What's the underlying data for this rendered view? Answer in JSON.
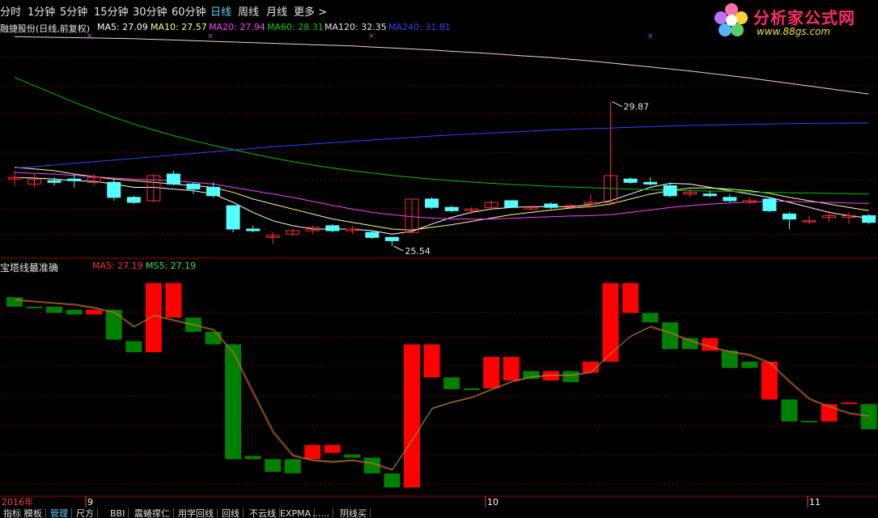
{
  "tabs": [
    {
      "label": "分时",
      "active": false
    },
    {
      "label": "1分钟",
      "active": false
    },
    {
      "label": "5分钟",
      "active": false
    },
    {
      "label": "15分钟",
      "active": false
    },
    {
      "label": "30分钟",
      "active": false
    },
    {
      "label": "60分钟",
      "active": false
    },
    {
      "label": "日线",
      "active": true
    },
    {
      "label": "周线",
      "active": false
    },
    {
      "label": "月线",
      "active": false
    },
    {
      "label": "更多 >",
      "active": false
    }
  ],
  "logo": {
    "text": "分析家公式网",
    "url": "www.88gs.com"
  },
  "main_legend": {
    "stock": "融捷股份(日线,前复权)",
    "ma5": "MA5: 27.09",
    "ma10": "MA10: 27.57",
    "ma20": "MA20: 27.94",
    "ma60": "MA60: 28.31",
    "ma120": "MA120: 32.35",
    "ma240": "MA240: 31.81"
  },
  "sub_legend": {
    "title": "宝塔线最准确",
    "ma5": "MA5: 27.19",
    "ms5": "MS5: 27.19"
  },
  "annotations": {
    "high": "29.87",
    "low": "25.54"
  },
  "x_axis": {
    "year": "2016年",
    "months": [
      "9",
      "10",
      "11"
    ]
  },
  "bottom_tabs": [
    "指标",
    "模板",
    "管理",
    "尺方",
    "BBI",
    "震蜷撑仁",
    "用学回线",
    "回线",
    "不云线",
    "EXPMA",
    "......",
    "阴线买"
  ],
  "colors": {
    "up": "#ff3030",
    "down": "#54ffff",
    "tower_up": "#ff0000",
    "tower_down": "#008000",
    "ma5": "#ffffff",
    "ma10": "#ffff80",
    "ma20": "#ff40ff",
    "ma60": "#00c000",
    "ma120": "#ffff80",
    "ma240": "#3040ff",
    "grid": "#7a0000"
  },
  "chart_data": [
    {
      "type": "candlestick",
      "title": "融捷股份(日线,前复权)",
      "candles": [
        {
          "o": 27.6,
          "h": 27.8,
          "l": 27.35,
          "c": 27.55,
          "dir": "up"
        },
        {
          "o": 27.55,
          "h": 27.7,
          "l": 27.3,
          "c": 27.4,
          "dir": "up"
        },
        {
          "o": 27.5,
          "h": 27.6,
          "l": 27.35,
          "c": 27.45,
          "dir": "down"
        },
        {
          "o": 27.55,
          "h": 27.7,
          "l": 27.3,
          "c": 27.5,
          "dir": "down"
        },
        {
          "o": 27.6,
          "h": 27.7,
          "l": 27.35,
          "c": 27.45,
          "dir": "up"
        },
        {
          "o": 27.45,
          "h": 27.55,
          "l": 26.9,
          "c": 27.0,
          "dir": "down"
        },
        {
          "o": 27.0,
          "h": 27.05,
          "l": 26.8,
          "c": 26.85,
          "dir": "down"
        },
        {
          "o": 26.9,
          "h": 27.7,
          "l": 26.85,
          "c": 27.65,
          "dir": "up"
        },
        {
          "o": 27.7,
          "h": 27.8,
          "l": 27.35,
          "c": 27.4,
          "dir": "down"
        },
        {
          "o": 27.4,
          "h": 27.45,
          "l": 27.1,
          "c": 27.25,
          "dir": "down"
        },
        {
          "o": 27.3,
          "h": 27.45,
          "l": 27.0,
          "c": 27.05,
          "dir": "down"
        },
        {
          "o": 26.75,
          "h": 26.75,
          "l": 25.95,
          "c": 26.05,
          "dir": "down"
        },
        {
          "o": 26.05,
          "h": 26.15,
          "l": 25.95,
          "c": 26.0,
          "dir": "down"
        },
        {
          "o": 25.8,
          "h": 25.95,
          "l": 25.6,
          "c": 25.85,
          "dir": "up"
        },
        {
          "o": 25.9,
          "h": 26.05,
          "l": 25.85,
          "c": 26.0,
          "dir": "up"
        },
        {
          "o": 26.0,
          "h": 26.15,
          "l": 25.9,
          "c": 26.1,
          "dir": "up"
        },
        {
          "o": 26.15,
          "h": 26.2,
          "l": 25.95,
          "c": 26.0,
          "dir": "down"
        },
        {
          "o": 26.05,
          "h": 26.15,
          "l": 25.9,
          "c": 26.0,
          "dir": "up"
        },
        {
          "o": 25.95,
          "h": 26.0,
          "l": 25.75,
          "c": 25.8,
          "dir": "down"
        },
        {
          "o": 25.8,
          "h": 25.8,
          "l": 25.54,
          "c": 25.7,
          "dir": "down"
        },
        {
          "o": 25.95,
          "h": 26.95,
          "l": 25.9,
          "c": 26.95,
          "dir": "up"
        },
        {
          "o": 26.95,
          "h": 27.0,
          "l": 26.65,
          "c": 26.7,
          "dir": "down"
        },
        {
          "o": 26.7,
          "h": 26.75,
          "l": 26.55,
          "c": 26.6,
          "dir": "down"
        },
        {
          "o": 26.6,
          "h": 26.7,
          "l": 26.5,
          "c": 26.65,
          "dir": "up"
        },
        {
          "o": 26.7,
          "h": 26.9,
          "l": 26.6,
          "c": 26.85,
          "dir": "up"
        },
        {
          "o": 26.9,
          "h": 26.9,
          "l": 26.7,
          "c": 26.7,
          "dir": "down"
        },
        {
          "o": 26.65,
          "h": 26.75,
          "l": 26.6,
          "c": 26.7,
          "dir": "up"
        },
        {
          "o": 26.8,
          "h": 26.85,
          "l": 26.65,
          "c": 26.7,
          "dir": "down"
        },
        {
          "o": 26.75,
          "h": 26.8,
          "l": 26.65,
          "c": 26.7,
          "dir": "up"
        },
        {
          "o": 26.8,
          "h": 27.1,
          "l": 26.7,
          "c": 26.85,
          "dir": "up"
        },
        {
          "o": 26.85,
          "h": 29.87,
          "l": 26.8,
          "c": 27.65,
          "dir": "up"
        },
        {
          "o": 27.55,
          "h": 27.6,
          "l": 27.4,
          "c": 27.45,
          "dir": "down"
        },
        {
          "o": 27.45,
          "h": 27.6,
          "l": 27.35,
          "c": 27.4,
          "dir": "down"
        },
        {
          "o": 27.35,
          "h": 27.45,
          "l": 27.0,
          "c": 27.05,
          "dir": "down"
        },
        {
          "o": 27.1,
          "h": 27.25,
          "l": 27.0,
          "c": 27.15,
          "dir": "up"
        },
        {
          "o": 27.1,
          "h": 27.2,
          "l": 27.0,
          "c": 27.05,
          "dir": "down"
        },
        {
          "o": 27.0,
          "h": 27.1,
          "l": 26.85,
          "c": 26.9,
          "dir": "down"
        },
        {
          "o": 26.85,
          "h": 27.0,
          "l": 26.8,
          "c": 26.9,
          "dir": "up"
        },
        {
          "o": 26.95,
          "h": 27.0,
          "l": 26.55,
          "c": 26.6,
          "dir": "down"
        },
        {
          "o": 26.5,
          "h": 26.55,
          "l": 26.05,
          "c": 26.35,
          "dir": "down"
        },
        {
          "o": 26.3,
          "h": 26.45,
          "l": 26.2,
          "c": 26.3,
          "dir": "up"
        },
        {
          "o": 26.4,
          "h": 26.6,
          "l": 26.25,
          "c": 26.45,
          "dir": "up"
        },
        {
          "o": 26.45,
          "h": 26.55,
          "l": 26.2,
          "c": 26.4,
          "dir": "up"
        },
        {
          "o": 26.45,
          "h": 26.5,
          "l": 26.2,
          "c": 26.25,
          "dir": "down"
        }
      ],
      "ma": {
        "ma5": [
          27.6,
          27.58,
          27.55,
          27.5,
          27.48,
          27.4,
          27.3,
          27.3,
          27.25,
          27.2,
          27.1,
          26.85,
          26.55,
          26.3,
          26.15,
          26.05,
          26.05,
          26.05,
          26.0,
          25.9,
          25.98,
          26.2,
          26.4,
          26.55,
          26.65,
          26.7,
          26.72,
          26.72,
          26.72,
          26.78,
          26.9,
          27.1,
          27.3,
          27.42,
          27.4,
          27.3,
          27.2,
          27.1,
          27.0,
          26.85,
          26.7,
          26.55,
          26.45,
          26.38
        ],
        "ma10": [
          27.9,
          27.85,
          27.8,
          27.7,
          27.62,
          27.55,
          27.5,
          27.45,
          27.4,
          27.35,
          27.3,
          27.15,
          26.95,
          26.8,
          26.65,
          26.5,
          26.35,
          26.25,
          26.15,
          26.05,
          26.02,
          26.1,
          26.18,
          26.28,
          26.38,
          26.48,
          26.55,
          26.62,
          26.68,
          26.72,
          26.8,
          26.95,
          27.1,
          27.2,
          27.28,
          27.28,
          27.25,
          27.2,
          27.12,
          27.0,
          26.9,
          26.8,
          26.7,
          26.6
        ],
        "ma20": [
          27.75,
          27.72,
          27.7,
          27.66,
          27.62,
          27.58,
          27.55,
          27.52,
          27.5,
          27.45,
          27.4,
          27.3,
          27.2,
          27.1,
          27.0,
          26.88,
          26.76,
          26.65,
          26.55,
          26.48,
          26.42,
          26.38,
          26.35,
          26.35,
          26.35,
          26.37,
          26.4,
          26.42,
          26.44,
          26.45,
          26.48,
          26.55,
          26.62,
          26.7,
          26.75,
          26.8,
          26.83,
          26.86,
          26.88,
          26.88,
          26.86,
          26.85,
          26.83,
          26.82
        ],
        "ma60": [
          30.6,
          30.35,
          30.1,
          29.85,
          29.62,
          29.4,
          29.2,
          29.02,
          28.85,
          28.7,
          28.56,
          28.43,
          28.3,
          28.18,
          28.07,
          27.97,
          27.88,
          27.8,
          27.73,
          27.66,
          27.6,
          27.55,
          27.5,
          27.46,
          27.42,
          27.39,
          27.36,
          27.33,
          27.31,
          27.29,
          27.27,
          27.25,
          27.23,
          27.22,
          27.2,
          27.19,
          27.18,
          27.16,
          27.15,
          27.14,
          27.13,
          27.12,
          27.11,
          27.1
        ],
        "ma120": [
          31.82,
          31.81,
          31.8,
          31.79,
          31.78,
          31.77,
          31.76,
          31.74,
          31.72,
          31.7,
          31.68,
          31.66,
          31.64,
          31.62,
          31.6,
          31.58,
          31.56,
          31.54,
          31.51,
          31.48,
          31.45,
          31.42,
          31.38,
          31.35,
          31.31,
          31.27,
          31.23,
          31.19,
          31.14,
          31.09,
          31.03,
          30.97,
          30.91,
          30.85,
          30.79,
          30.72,
          30.65,
          30.58,
          30.5,
          30.42,
          30.34,
          30.26,
          30.18,
          30.1
        ],
        "ma240": [
          27.88,
          27.92,
          27.97,
          28.02,
          28.07,
          28.12,
          28.17,
          28.22,
          28.27,
          28.32,
          28.37,
          28.42,
          28.47,
          28.52,
          28.56,
          28.6,
          28.64,
          28.68,
          28.72,
          28.76,
          28.8,
          28.84,
          28.87,
          28.9,
          28.93,
          28.96,
          28.99,
          29.02,
          29.04,
          29.06,
          29.08,
          29.1,
          29.12,
          29.14,
          29.16,
          29.17,
          29.18,
          29.19,
          29.2,
          29.21,
          29.22,
          29.22,
          29.23,
          29.23
        ]
      },
      "ylim": [
        25.2,
        31.9
      ]
    },
    {
      "type": "tower",
      "title": "宝塔线最准确",
      "bars": [
        {
          "b": 0,
          "t": 12,
          "c": "green"
        },
        {
          "b": 0,
          "t": 0,
          "c": "green"
        },
        {
          "b": -8,
          "t": 0,
          "c": "green"
        },
        {
          "b": -10,
          "t": -4,
          "c": "green"
        },
        {
          "b": -10,
          "t": -4,
          "c": "red"
        },
        {
          "b": -42,
          "t": -4,
          "c": "green"
        },
        {
          "b": -58,
          "t": -44,
          "c": "green"
        },
        {
          "b": -58,
          "t": 30,
          "c": "red"
        },
        {
          "b": -14,
          "t": 30,
          "c": "red"
        },
        {
          "b": -32,
          "t": -14,
          "c": "green"
        },
        {
          "b": -48,
          "t": -32,
          "c": "green"
        },
        {
          "b": -194,
          "t": -48,
          "c": "green"
        },
        {
          "b": -194,
          "t": -190,
          "c": "green"
        },
        {
          "b": -210,
          "t": -194,
          "c": "green"
        },
        {
          "b": -212,
          "t": -194,
          "c": "green"
        },
        {
          "b": -194,
          "t": -176,
          "c": "red"
        },
        {
          "b": -186,
          "t": -176,
          "c": "red"
        },
        {
          "b": -192,
          "t": -188,
          "c": "green"
        },
        {
          "b": -212,
          "t": -192,
          "c": "green"
        },
        {
          "b": -230,
          "t": -212,
          "c": "green"
        },
        {
          "b": -230,
          "t": -48,
          "c": "red"
        },
        {
          "b": -90,
          "t": -48,
          "c": "red"
        },
        {
          "b": -105,
          "t": -90,
          "c": "green"
        },
        {
          "b": -105,
          "t": -104,
          "c": "green"
        },
        {
          "b": -104,
          "t": -64,
          "c": "red"
        },
        {
          "b": -94,
          "t": -64,
          "c": "red"
        },
        {
          "b": -92,
          "t": -82,
          "c": "green"
        },
        {
          "b": -94,
          "t": -82,
          "c": "red"
        },
        {
          "b": -96,
          "t": -82,
          "c": "green"
        },
        {
          "b": -84,
          "t": -70,
          "c": "red"
        },
        {
          "b": -70,
          "t": 30,
          "c": "red"
        },
        {
          "b": -8,
          "t": 30,
          "c": "red"
        },
        {
          "b": -20,
          "t": -8,
          "c": "green"
        },
        {
          "b": -54,
          "t": -20,
          "c": "green"
        },
        {
          "b": -54,
          "t": -40,
          "c": "green"
        },
        {
          "b": -56,
          "t": -40,
          "c": "red"
        },
        {
          "b": -78,
          "t": -56,
          "c": "green"
        },
        {
          "b": -78,
          "t": -70,
          "c": "green"
        },
        {
          "b": -118,
          "t": -70,
          "c": "red"
        },
        {
          "b": -146,
          "t": -118,
          "c": "green"
        },
        {
          "b": -146,
          "t": -145,
          "c": "green"
        },
        {
          "b": -146,
          "t": -124,
          "c": "red"
        },
        {
          "b": -124,
          "t": -122,
          "c": "red"
        },
        {
          "b": -156,
          "t": -124,
          "c": "green"
        }
      ],
      "ma5": [
        8,
        6,
        4,
        2,
        -2,
        -8,
        -26,
        -12,
        -18,
        -24,
        -30,
        -60,
        -110,
        -160,
        -190,
        -196,
        -198,
        -196,
        -200,
        -208,
        -170,
        -130,
        -122,
        -116,
        -106,
        -96,
        -90,
        -88,
        -88,
        -84,
        -60,
        -38,
        -26,
        -34,
        -44,
        -52,
        -58,
        -62,
        -72,
        -96,
        -118,
        -128,
        -136,
        -140
      ],
      "ylim": [
        -240,
        40
      ]
    }
  ]
}
